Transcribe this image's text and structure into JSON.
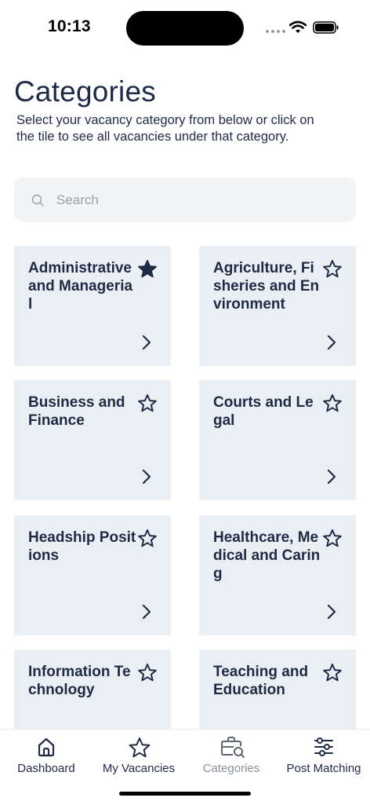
{
  "status_bar": {
    "time": "10:13"
  },
  "header": {
    "title": "Categories",
    "subtitle": "Select your vacancy category from below or click on the tile to see all vacancies under that category."
  },
  "search": {
    "placeholder": "Search",
    "value": ""
  },
  "tiles": [
    {
      "title": "Administrative and Managerial",
      "favorite": true
    },
    {
      "title": "Agriculture, Fisheries and Environment",
      "favorite": false
    },
    {
      "title": "Business and Finance",
      "favorite": false
    },
    {
      "title": "Courts and Legal",
      "favorite": false
    },
    {
      "title": "Headship Positions",
      "favorite": false
    },
    {
      "title": "Healthcare, Medical and Caring",
      "favorite": false
    },
    {
      "title": "Information Technology",
      "favorite": false
    },
    {
      "title": "Teaching and Education",
      "favorite": false
    }
  ],
  "tab_bar": {
    "items": [
      {
        "label": "Dashboard",
        "icon": "home-icon"
      },
      {
        "label": "My Vacancies",
        "icon": "star-icon"
      },
      {
        "label": "Categories",
        "icon": "briefcase-search-icon",
        "active": true
      },
      {
        "label": "Post Matching",
        "icon": "sliders-icon"
      }
    ]
  },
  "colors": {
    "primary_text": "#1f2a44",
    "tile_background": "#e9eff3",
    "search_background": "#f3f4f5",
    "inactive_tab": "#8a8f96"
  }
}
